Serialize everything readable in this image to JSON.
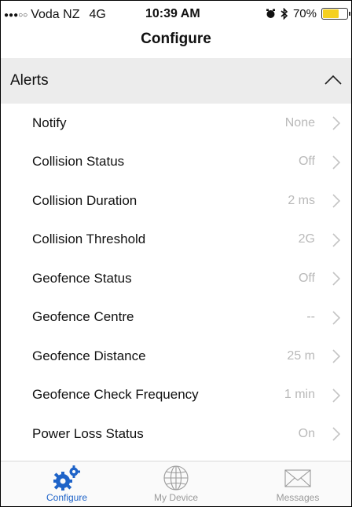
{
  "status_bar": {
    "carrier": "Voda NZ",
    "network": "4G",
    "time": "10:39 AM",
    "battery": "70%",
    "battery_level": 0.7
  },
  "nav": {
    "title": "Configure"
  },
  "section": {
    "title": "Alerts"
  },
  "rows": [
    {
      "label": "Notify",
      "value": "None"
    },
    {
      "label": "Collision Status",
      "value": "Off"
    },
    {
      "label": "Collision Duration",
      "value": "2 ms"
    },
    {
      "label": "Collision Threshold",
      "value": "2G"
    },
    {
      "label": "Geofence Status",
      "value": "Off"
    },
    {
      "label": "Geofence Centre",
      "value": "--"
    },
    {
      "label": "Geofence Distance",
      "value": "25 m"
    },
    {
      "label": "Geofence Check Frequency",
      "value": "1 min"
    },
    {
      "label": "Power Loss Status",
      "value": "On"
    }
  ],
  "tabs": [
    {
      "label": "Configure",
      "icon": "gears-icon",
      "active": true
    },
    {
      "label": "My Device",
      "icon": "globe-icon",
      "active": false
    },
    {
      "label": "Messages",
      "icon": "envelope-icon",
      "active": false
    }
  ],
  "colors": {
    "accent": "#1e63c8",
    "header_bg": "#ececec",
    "value_text": "#b9b9b9",
    "battery": "#f5d020"
  }
}
